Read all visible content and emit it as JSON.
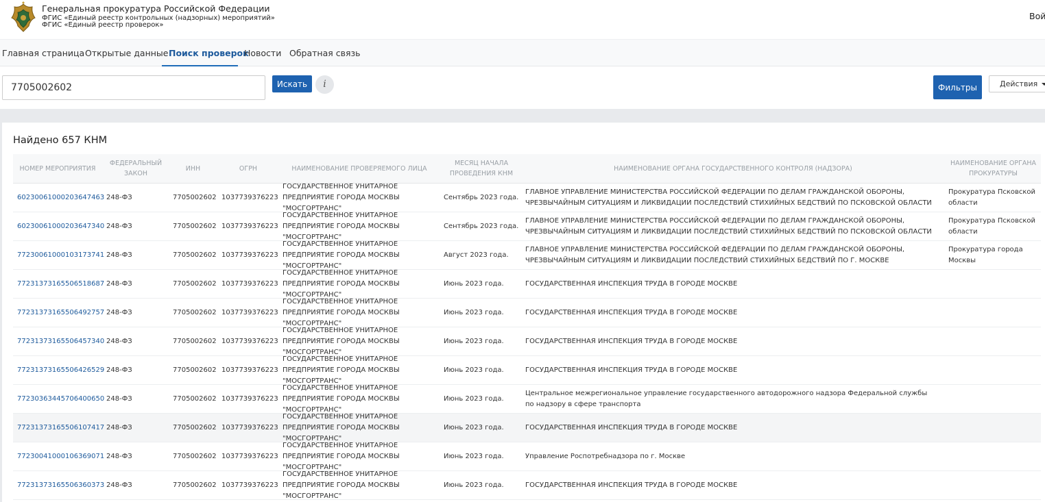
{
  "header": {
    "org_title": "Генеральная прокуратура Российской Федерации",
    "subtitle1": "ФГИС «Единый реестр контрольных (надзорных) мероприятий»",
    "subtitle2": "ФГИС «Единый реестр проверок»",
    "login": "Войт"
  },
  "nav": {
    "items": [
      {
        "label": "Главная страница"
      },
      {
        "label": "Открытые данные"
      },
      {
        "label": "Поиск проверок"
      },
      {
        "label": "Новости"
      },
      {
        "label": "Обратная связь"
      }
    ],
    "active_index": 2
  },
  "search": {
    "value": "7705002602",
    "button_label": "Искать",
    "info_label": "i",
    "filters_label": "Фильтры",
    "actions_label": "Действия"
  },
  "results": {
    "title": "Найдено 657 КНМ",
    "columns": [
      "Номер мероприятия",
      "Федеральный закон",
      "ИНН",
      "ОГРН",
      "Наименование проверяемого лица",
      "Месяц начала проведения КНМ",
      "Наименование органа государственного контроля (надзора)",
      "Наименование органа прокуратуры"
    ],
    "rows": [
      {
        "number": "60230061000203647463",
        "law": "248-ФЗ",
        "inn": "7705002602",
        "ogrn": "1037739376223",
        "subject": "ГОСУДАРСТВЕННОЕ УНИТАРНОЕ ПРЕДПРИЯТИЕ ГОРОДА МОСКВЫ \"МОСГОРТРАНС\"",
        "month": "Сентябрь 2023 года.",
        "authority": "ГЛАВНОЕ УПРАВЛЕНИЕ МИНИСТЕРСТВА РОССИЙСКОЙ ФЕДЕРАЦИИ ПО ДЕЛАМ ГРАЖДАНСКОЙ ОБОРОНЫ, ЧРЕЗВЫЧАЙНЫМ СИТУАЦИЯМ И ЛИКВИДАЦИИ ПОСЛЕДСТВИЙ СТИХИЙНЫХ БЕДСТВИЙ ПО ПСКОВСКОЙ ОБЛАСТИ",
        "prosecutor": "Прокуратура Псковской области"
      },
      {
        "number": "60230061000203647340",
        "law": "248-ФЗ",
        "inn": "7705002602",
        "ogrn": "1037739376223",
        "subject": "ГОСУДАРСТВЕННОЕ УНИТАРНОЕ ПРЕДПРИЯТИЕ ГОРОДА МОСКВЫ \"МОСГОРТРАНС\"",
        "month": "Сентябрь 2023 года.",
        "authority": "ГЛАВНОЕ УПРАВЛЕНИЕ МИНИСТЕРСТВА РОССИЙСКОЙ ФЕДЕРАЦИИ ПО ДЕЛАМ ГРАЖДАНСКОЙ ОБОРОНЫ, ЧРЕЗВЫЧАЙНЫМ СИТУАЦИЯМ И ЛИКВИДАЦИИ ПОСЛЕДСТВИЙ СТИХИЙНЫХ БЕДСТВИЙ ПО ПСКОВСКОЙ ОБЛАСТИ",
        "prosecutor": "Прокуратура Псковской области"
      },
      {
        "number": "77230061000103173741",
        "law": "248-ФЗ",
        "inn": "7705002602",
        "ogrn": "1037739376223",
        "subject": "ГОСУДАРСТВЕННОЕ УНИТАРНОЕ ПРЕДПРИЯТИЕ ГОРОДА МОСКВЫ \"МОСГОРТРАНС\"",
        "month": "Август 2023 года.",
        "authority": "ГЛАВНОЕ УПРАВЛЕНИЕ МИНИСТЕРСТВА РОССИЙСКОЙ ФЕДЕРАЦИИ ПО ДЕЛАМ ГРАЖДАНСКОЙ ОБОРОНЫ, ЧРЕЗВЫЧАЙНЫМ СИТУАЦИЯМ И ЛИКВИДАЦИИ ПОСЛЕДСТВИЙ СТИХИЙНЫХ БЕДСТВИЙ ПО Г. МОСКВЕ",
        "prosecutor": "Прокуратура города Москвы"
      },
      {
        "number": "77231373165506518687",
        "law": "248-ФЗ",
        "inn": "7705002602",
        "ogrn": "1037739376223",
        "subject": "ГОСУДАРСТВЕННОЕ УНИТАРНОЕ ПРЕДПРИЯТИЕ ГОРОДА МОСКВЫ \"МОСГОРТРАНС\"",
        "month": "Июнь 2023 года.",
        "authority": "ГОСУДАРСТВЕННАЯ ИНСПЕКЦИЯ ТРУДА В ГОРОДЕ МОСКВЕ",
        "prosecutor": ""
      },
      {
        "number": "77231373165506492757",
        "law": "248-ФЗ",
        "inn": "7705002602",
        "ogrn": "1037739376223",
        "subject": "ГОСУДАРСТВЕННОЕ УНИТАРНОЕ ПРЕДПРИЯТИЕ ГОРОДА МОСКВЫ \"МОСГОРТРАНС\"",
        "month": "Июнь 2023 года.",
        "authority": "ГОСУДАРСТВЕННАЯ ИНСПЕКЦИЯ ТРУДА В ГОРОДЕ МОСКВЕ",
        "prosecutor": ""
      },
      {
        "number": "77231373165506457340",
        "law": "248-ФЗ",
        "inn": "7705002602",
        "ogrn": "1037739376223",
        "subject": "ГОСУДАРСТВЕННОЕ УНИТАРНОЕ ПРЕДПРИЯТИЕ ГОРОДА МОСКВЫ \"МОСГОРТРАНС\"",
        "month": "Июнь 2023 года.",
        "authority": "ГОСУДАРСТВЕННАЯ ИНСПЕКЦИЯ ТРУДА В ГОРОДЕ МОСКВЕ",
        "prosecutor": ""
      },
      {
        "number": "77231373165506426529",
        "law": "248-ФЗ",
        "inn": "7705002602",
        "ogrn": "1037739376223",
        "subject": "ГОСУДАРСТВЕННОЕ УНИТАРНОЕ ПРЕДПРИЯТИЕ ГОРОДА МОСКВЫ \"МОСГОРТРАНС\"",
        "month": "Июнь 2023 года.",
        "authority": "ГОСУДАРСТВЕННАЯ ИНСПЕКЦИЯ ТРУДА В ГОРОДЕ МОСКВЕ",
        "prosecutor": ""
      },
      {
        "number": "77230363445706400650",
        "law": "248-ФЗ",
        "inn": "7705002602",
        "ogrn": "1037739376223",
        "subject": "ГОСУДАРСТВЕННОЕ УНИТАРНОЕ ПРЕДПРИЯТИЕ ГОРОДА МОСКВЫ \"МОСГОРТРАНС\"",
        "month": "Июнь 2023 года.",
        "authority": "Центральное межрегиональное управление государственного автодорожного надзора Федеральной службы по надзору в сфере транспорта",
        "prosecutor": ""
      },
      {
        "number": "77231373165506107417",
        "law": "248-ФЗ",
        "inn": "7705002602",
        "ogrn": "1037739376223",
        "subject": "ГОСУДАРСТВЕННОЕ УНИТАРНОЕ ПРЕДПРИЯТИЕ ГОРОДА МОСКВЫ \"МОСГОРТРАНС\"",
        "month": "Июнь 2023 года.",
        "authority": "ГОСУДАРСТВЕННАЯ ИНСПЕКЦИЯ ТРУДА В ГОРОДЕ МОСКВЕ",
        "prosecutor": ""
      },
      {
        "number": "77230041000106369071",
        "law": "248-ФЗ",
        "inn": "7705002602",
        "ogrn": "1037739376223",
        "subject": "ГОСУДАРСТВЕННОЕ УНИТАРНОЕ ПРЕДПРИЯТИЕ ГОРОДА МОСКВЫ \"МОСГОРТРАНС\"",
        "month": "Июнь 2023 года.",
        "authority": "Управление Роспотребнадзора по г. Москве",
        "prosecutor": ""
      },
      {
        "number": "77231373165506360373",
        "law": "248-ФЗ",
        "inn": "7705002602",
        "ogrn": "1037739376223",
        "subject": "ГОСУДАРСТВЕННОЕ УНИТАРНОЕ ПРЕДПРИЯТИЕ ГОРОДА МОСКВЫ \"МОСГОРТРАНС\"",
        "month": "Июнь 2023 года.",
        "authority": "ГОСУДАРСТВЕННАЯ ИНСПЕКЦИЯ ТРУДА В ГОРОДЕ МОСКВЕ",
        "prosecutor": ""
      }
    ],
    "highlight_row_index": 8
  }
}
